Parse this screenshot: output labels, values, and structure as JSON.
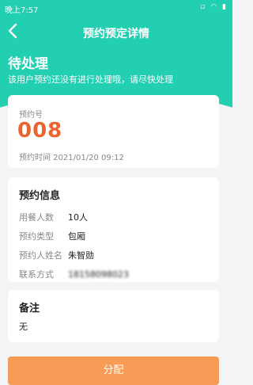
{
  "status_bar": {
    "time": "晚上7:57",
    "icons": "▫ ◠ ▮"
  },
  "nav": {
    "title": "预约预定详情"
  },
  "status": {
    "title": "待处理",
    "description": "该用户预约还没有进行处理哦，请尽快处理"
  },
  "booking": {
    "label": "预约号",
    "number": "008",
    "time": "预约时间 2021/01/20 09:12"
  },
  "info": {
    "title": "预约信息",
    "rows": [
      {
        "key": "用餐人数",
        "value": "10人"
      },
      {
        "key": "预约类型",
        "value": "包厢"
      },
      {
        "key": "预约人姓名",
        "value": "朱智勋"
      },
      {
        "key": "联系方式",
        "value": "18158098023"
      }
    ]
  },
  "remark": {
    "title": "备注",
    "text": "无"
  },
  "action": {
    "label": "分配"
  },
  "colors": {
    "header": "#22cfb0",
    "accent_number": "#e9642f",
    "button": "#f89b56"
  }
}
